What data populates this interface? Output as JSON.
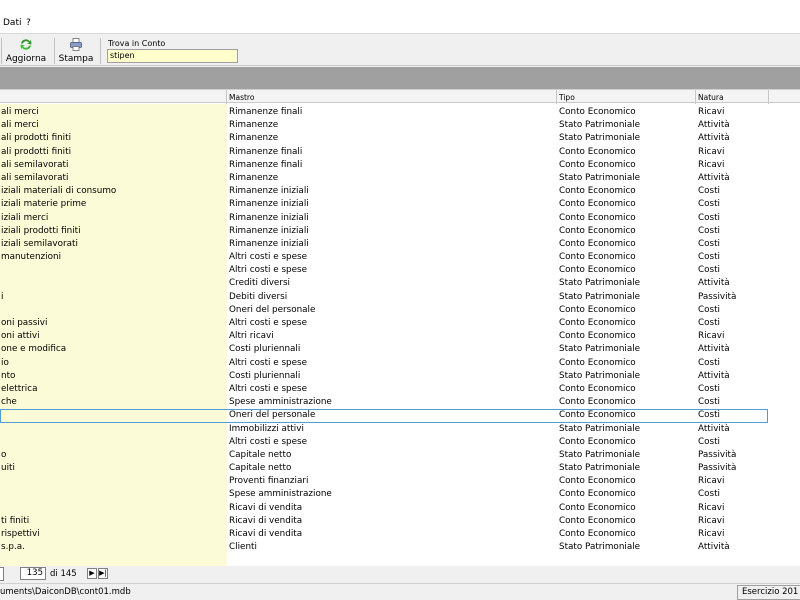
{
  "menu": {
    "item_dati": "Dati",
    "item_help": "?"
  },
  "toolbar": {
    "refresh_label": "Aggiorna",
    "print_label": "Stampa",
    "find_label": "Trova in Conto",
    "find_value": "stipen"
  },
  "grid": {
    "headers": [
      "",
      "Mastro",
      "Tipo",
      "Natura"
    ],
    "rows": [
      [
        "ali merci",
        "Rimanenze finali",
        "Conto Economico",
        "Ricavi"
      ],
      [
        "ali merci",
        "Rimanenze",
        "Stato Patrimoniale",
        "Attività"
      ],
      [
        "ali prodotti finiti",
        "Rimanenze",
        "Stato Patrimoniale",
        "Attività"
      ],
      [
        "ali prodotti finiti",
        "Rimanenze finali",
        "Conto Economico",
        "Ricavi"
      ],
      [
        "ali semilavorati",
        "Rimanenze finali",
        "Conto Economico",
        "Ricavi"
      ],
      [
        "ali semilavorati",
        "Rimanenze",
        "Stato Patrimoniale",
        "Attività"
      ],
      [
        "iziali materiali di consumo",
        "Rimanenze iniziali",
        "Conto Economico",
        "Costi"
      ],
      [
        "iziali materie prime",
        "Rimanenze iniziali",
        "Conto Economico",
        "Costi"
      ],
      [
        "iziali merci",
        "Rimanenze iniziali",
        "Conto Economico",
        "Costi"
      ],
      [
        "iziali prodotti finiti",
        "Rimanenze iniziali",
        "Conto Economico",
        "Costi"
      ],
      [
        "iziali semilavorati",
        "Rimanenze iniziali",
        "Conto Economico",
        "Costi"
      ],
      [
        "manutenzioni",
        "Altri costi e spese",
        "Conto Economico",
        "Costi"
      ],
      [
        "",
        "Altri costi e spese",
        "Conto Economico",
        "Costi"
      ],
      [
        "",
        "Crediti diversi",
        "Stato Patrimoniale",
        "Attività"
      ],
      [
        "i",
        "Debiti diversi",
        "Stato Patrimoniale",
        "Passività"
      ],
      [
        "",
        "Oneri del personale",
        "Conto Economico",
        "Costi"
      ],
      [
        "oni passivi",
        "Altri costi e spese",
        "Conto Economico",
        "Costi"
      ],
      [
        "oni attivi",
        "Altri ricavi",
        "Conto Economico",
        "Ricavi"
      ],
      [
        "one e modifica",
        "Costi pluriennali",
        "Stato Patrimoniale",
        "Attività"
      ],
      [
        "io",
        "Altri costi e spese",
        "Conto Economico",
        "Costi"
      ],
      [
        "nto",
        "Costi pluriennali",
        "Stato Patrimoniale",
        "Attività"
      ],
      [
        "elettrica",
        "Altri costi e spese",
        "Conto Economico",
        "Costi"
      ],
      [
        "che",
        "Spese amministrazione",
        "Conto Economico",
        "Costi"
      ],
      [
        "",
        "Oneri del personale",
        "Conto Economico",
        "Costi"
      ],
      [
        "",
        "Immobilizzi attivi",
        "Stato Patrimoniale",
        "Attività"
      ],
      [
        "",
        "Altri costi e spese",
        "Conto Economico",
        "Costi"
      ],
      [
        "o",
        "Capitale netto",
        "Stato Patrimoniale",
        "Passività"
      ],
      [
        "uiti",
        "Capitale netto",
        "Stato Patrimoniale",
        "Passività"
      ],
      [
        "",
        "Proventi finanziari",
        "Conto Economico",
        "Ricavi"
      ],
      [
        "",
        "Spese amministrazione",
        "Conto Economico",
        "Costi"
      ],
      [
        "",
        "Ricavi di vendita",
        "Conto Economico",
        "Ricavi"
      ],
      [
        "ti finiti",
        "Ricavi di vendita",
        "Conto Economico",
        "Ricavi"
      ],
      [
        "rispettivi",
        "Ricavi di vendita",
        "Conto Economico",
        "Ricavi"
      ],
      [
        "s.p.a.",
        "Clienti",
        "Stato Patrimoniale",
        "Attività"
      ]
    ],
    "selected_row": 23
  },
  "navigator": {
    "current": "135",
    "of_text": "di 145"
  },
  "status": {
    "path": "uments\\DaiconDB\\cont01.mdb",
    "year": "Esercizio 201"
  },
  "colors": {
    "grid_highlight": "#fbfbd7",
    "selection_border": "#4d9fd6",
    "find_bg": "#ffffcc"
  }
}
